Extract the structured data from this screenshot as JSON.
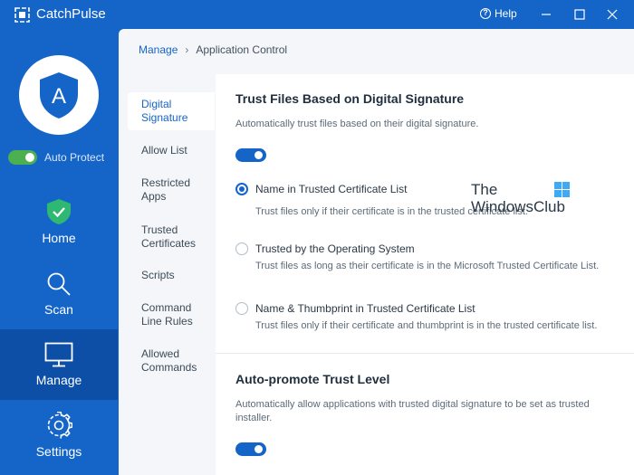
{
  "app": {
    "title": "CatchPulse"
  },
  "titlebar": {
    "help_label": "Help"
  },
  "sidebar": {
    "auto_protect_label": "Auto Protect",
    "nav": [
      {
        "label": "Home",
        "icon": "shield-check-icon"
      },
      {
        "label": "Scan",
        "icon": "magnifier-icon"
      },
      {
        "label": "Manage",
        "icon": "monitor-icon",
        "active": true
      },
      {
        "label": "Settings",
        "icon": "gear-icon"
      }
    ]
  },
  "breadcrumb": {
    "parent": "Manage",
    "current": "Application Control"
  },
  "subnav": [
    {
      "label": "Digital Signature",
      "active": true
    },
    {
      "label": "Allow List"
    },
    {
      "label": "Restricted Apps"
    },
    {
      "label": "Trusted Certificates"
    },
    {
      "label": "Scripts"
    },
    {
      "label": "Command Line Rules"
    },
    {
      "label": "Allowed Commands"
    }
  ],
  "trust_section": {
    "title": "Trust Files Based on Digital Signature",
    "description": "Automatically trust files based on their digital signature.",
    "enabled": true,
    "options": [
      {
        "label": "Name in Trusted Certificate List",
        "description": "Trust files only if their certificate is in the trusted certificate list.",
        "checked": true
      },
      {
        "label": "Trusted by the Operating System",
        "description": "Trust files as long as their certificate is in the Microsoft Trusted Certificate List.",
        "checked": false
      },
      {
        "label": "Name & Thumbprint in Trusted Certificate List",
        "description": "Trust files only if their certificate and thumbprint is in the trusted certificate list.",
        "checked": false
      }
    ]
  },
  "promote_section": {
    "title": "Auto-promote Trust Level",
    "description": "Automatically allow applications with trusted digital signature to be set as trusted installer.",
    "enabled": true
  },
  "watermark": {
    "line1": "The",
    "line2": "WindowsClub"
  },
  "colors": {
    "brand": "#1565c9",
    "active_nav": "#0d4ea6",
    "protect_green": "#4caf50"
  }
}
